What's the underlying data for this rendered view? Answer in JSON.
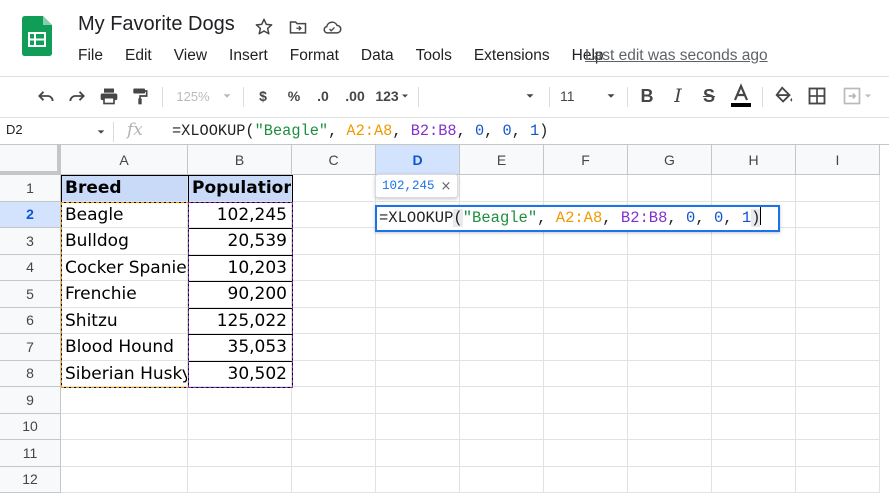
{
  "app": {
    "doc_title": "My Favorite Dogs",
    "brand_color": "#0f9d58",
    "title_icons": [
      "star-icon",
      "move-to-folder-icon",
      "cloud-saved-icon"
    ]
  },
  "menu": {
    "items": [
      "File",
      "Edit",
      "View",
      "Insert",
      "Format",
      "Data",
      "Tools",
      "Extensions",
      "Help"
    ],
    "last_edit": "Last edit was seconds ago"
  },
  "toolbar": {
    "zoom": "125%",
    "currency": "$",
    "percent": "%",
    "decrease_decimal": ".0",
    "increase_decimal": ".00",
    "more_formats": "123",
    "font_size": "11",
    "bold": "B",
    "italic": "I",
    "strikethrough": "S"
  },
  "formula_bar": {
    "cell_ref": "D2",
    "fx_label": "fx",
    "formula_parts": [
      "=XLOOKUP(",
      "\"Beagle\"",
      ", ",
      "A2:A8",
      ", ",
      "B2:B8",
      ", ",
      "0",
      ", ",
      "0",
      ", ",
      "1",
      ")"
    ]
  },
  "grid": {
    "columns": [
      "A",
      "B",
      "C",
      "D",
      "E",
      "F",
      "G",
      "H",
      "I"
    ],
    "active_column": "D",
    "rows": [
      "1",
      "2",
      "3",
      "4",
      "5",
      "6",
      "7",
      "8",
      "9",
      "10",
      "11",
      "12"
    ],
    "active_row": "2",
    "header_fill": "#c9daf8",
    "table_header": [
      "Breed",
      "Population"
    ],
    "table_rows": [
      [
        "Beagle",
        "102,245"
      ],
      [
        "Bulldog",
        "20,539"
      ],
      [
        "Cocker Spaniel",
        "10,203"
      ],
      [
        "Frenchie",
        "90,200"
      ],
      [
        "Shitzu",
        "125,022"
      ],
      [
        "Blood Hound",
        "35,053"
      ],
      [
        "Siberian Husky",
        "30,502"
      ]
    ]
  },
  "editor": {
    "formula_parts": [
      "=XLOOKUP",
      "(",
      "\"Beagle\"",
      ", ",
      "A2:A8",
      ", ",
      "B2:B8",
      ", ",
      "0",
      ", ",
      "0",
      ", ",
      "1",
      ")"
    ],
    "preview_value": "102,245",
    "preview_close": "×"
  },
  "colors": {
    "string": "#1e8e3e",
    "range_a": "#f29900",
    "range_b": "#8430ce",
    "number": "#1155cc",
    "selection": "#1a73e8"
  }
}
